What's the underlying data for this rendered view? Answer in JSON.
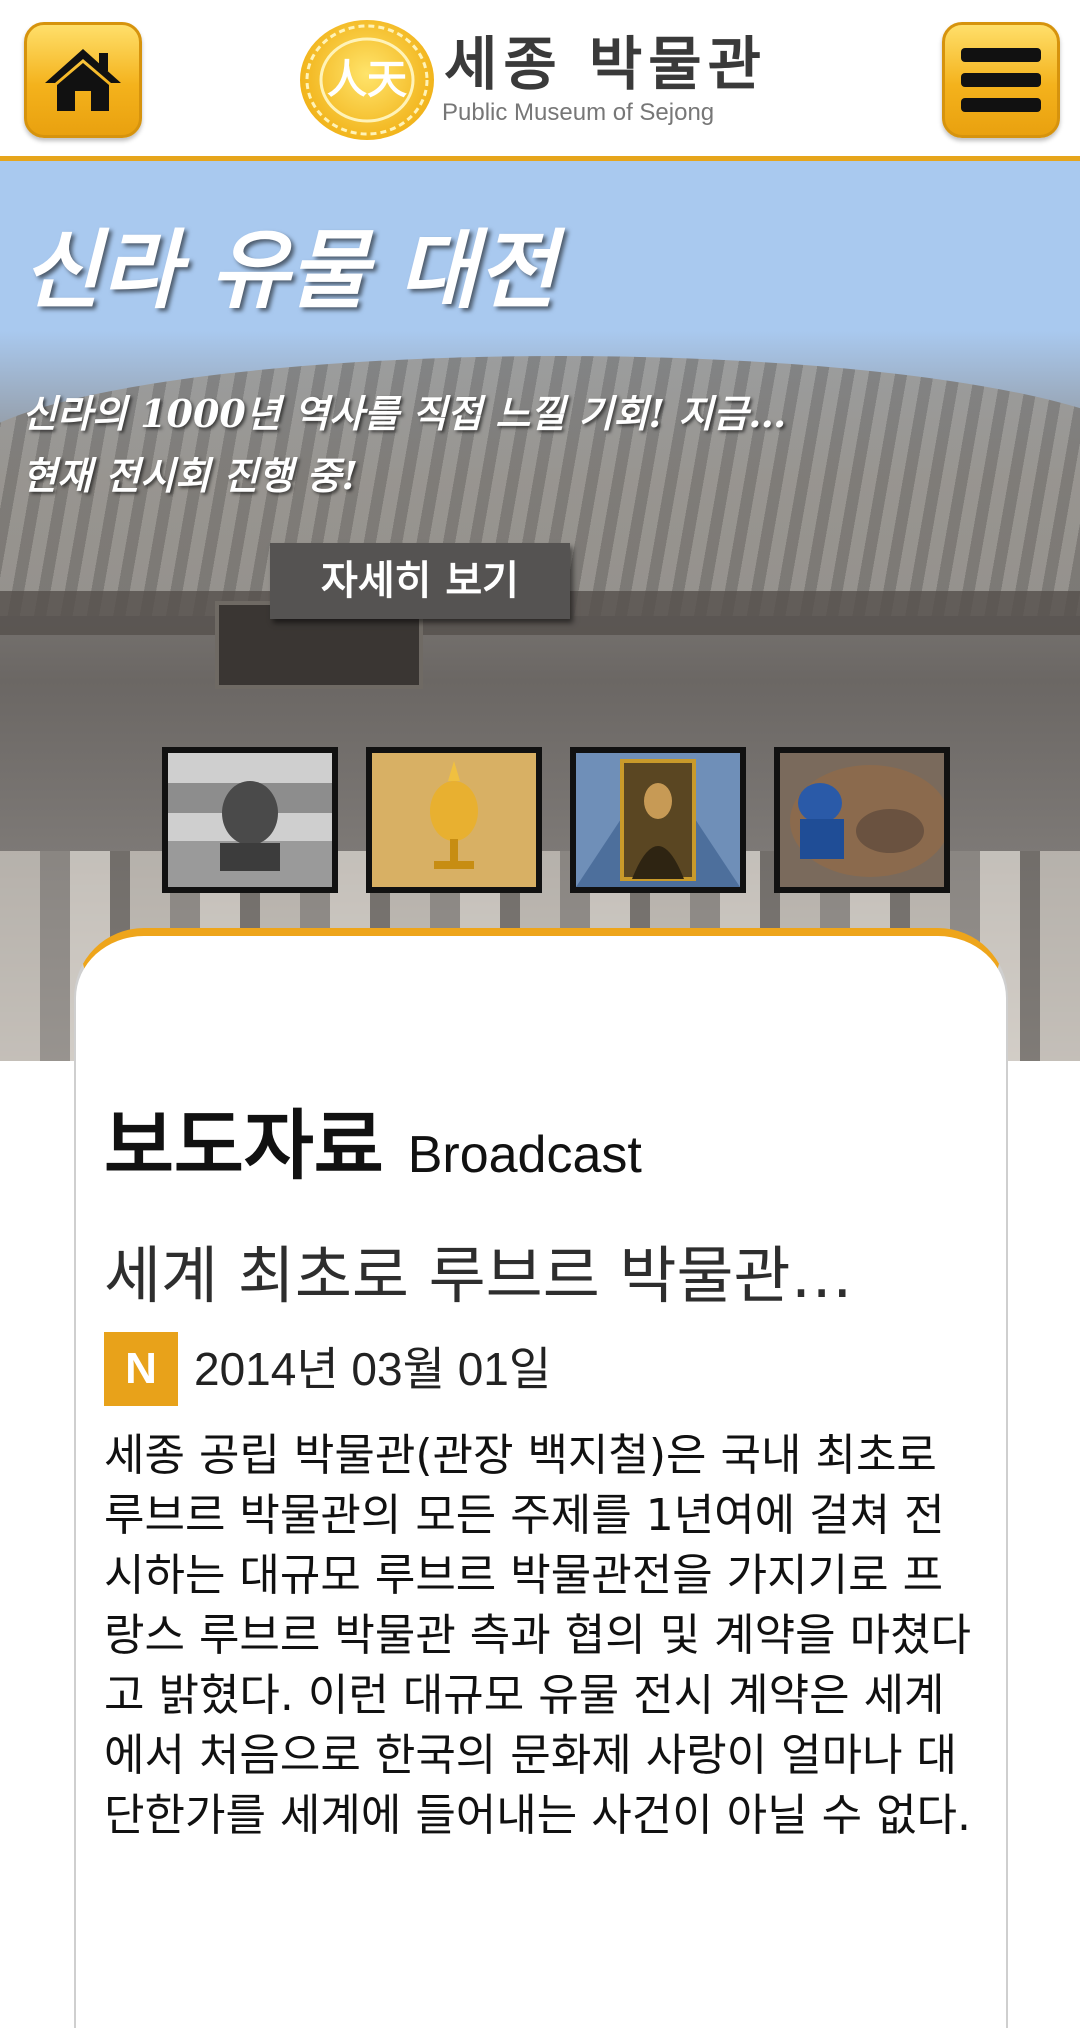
{
  "header": {
    "home_icon": "home-icon",
    "menu_icon": "hamburger-menu-icon",
    "logo": {
      "seal_text": "人天",
      "title_ko": "세종 박물관",
      "title_en": "Public Museum of Sejong"
    },
    "accent_color": "#e6a51b"
  },
  "hero": {
    "title": "신라 유물 대전",
    "subtitle_line1": "신라의 1000년 역사를 직접 느낄 기회! 지금…",
    "subtitle_line2": "현재 전시회 진행 중!",
    "button_label": "자세히 보기",
    "thumbnails": [
      {
        "icon": "stone-lion-statue-image"
      },
      {
        "icon": "golden-crown-artifact-image"
      },
      {
        "icon": "mona-lisa-painting-image"
      },
      {
        "icon": "excavation-worker-image"
      }
    ]
  },
  "news": {
    "section_title_ko": "보도자료",
    "section_title_en": "Broadcast",
    "headline": "세계 최초로 루브르 박물관…",
    "badge": "N",
    "date": "2014년 03월 01일",
    "body": "세종 공립 박물관(관장 백지철)은 국내 최초로 루브르 박물관의 모든 주제를 1년여에 걸쳐 전시하는 대규모 루브르 박물관전을 가지기로 프랑스 루브르 박물관 측과 협의 및 계약을 마쳤다고 밝혔다. 이런 대규모 유물 전시 계약은 세계에서 처음으로 한국의 문화제 사랑이 얼마나 대단한가를 세계에 들어내는 사건이 아닐 수 없다."
  }
}
